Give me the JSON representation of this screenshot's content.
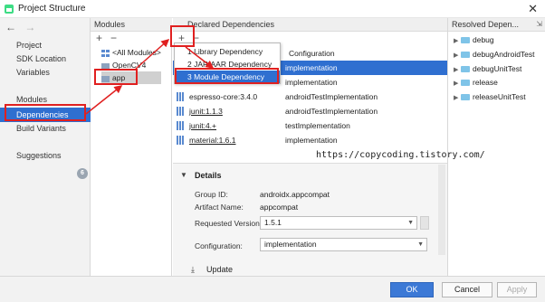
{
  "window": {
    "title": "Project Structure",
    "close_glyph": "✕"
  },
  "nav": {
    "back_glyph": "←",
    "forward_glyph": "→",
    "items": [
      {
        "label": "Project"
      },
      {
        "label": "SDK Location"
      },
      {
        "label": "Variables"
      },
      {
        "label": "Modules"
      },
      {
        "label": "Dependencies"
      },
      {
        "label": "Build Variants"
      },
      {
        "label": "Suggestions"
      }
    ],
    "suggestions_count": "6"
  },
  "modules": {
    "header": "Modules",
    "add_glyph": "+",
    "remove_glyph": "−",
    "items": [
      {
        "label": "<All Modules>"
      },
      {
        "label": "OpenCV4"
      },
      {
        "label": "app"
      }
    ]
  },
  "deps": {
    "header": "Declared Dependencies",
    "add_glyph": "+",
    "remove_glyph": "−",
    "config_header": "Configuration",
    "rows": [
      {
        "name": "",
        "conf": "implementation"
      },
      {
        "name": "",
        "conf": "implementation"
      },
      {
        "name": "espresso-core:3.4.0",
        "conf": "androidTestImplementation"
      },
      {
        "name": "junit:1.1.3",
        "conf": "androidTestImplementation"
      },
      {
        "name": "junit:4.+",
        "conf": "testImplementation"
      },
      {
        "name": "material:1.6.1",
        "conf": "implementation"
      }
    ],
    "popup": [
      {
        "label": "1  Library Dependency"
      },
      {
        "label": "2  JAR/AAR Dependency"
      },
      {
        "label": "3  Module Dependency"
      }
    ]
  },
  "details": {
    "title": "Details",
    "group_label": "Group ID:",
    "group_value": "androidx.appcompat",
    "artifact_label": "Artifact Name:",
    "artifact_value": "appcompat",
    "version_label": "Requested Version:",
    "version_value": "1.5.1",
    "config_label": "Configuration:",
    "config_value": "implementation",
    "update_label": "Update"
  },
  "resolved": {
    "header": "Resolved Depen...",
    "items": [
      {
        "label": "debug"
      },
      {
        "label": "debugAndroidTest"
      },
      {
        "label": "debugUnitTest"
      },
      {
        "label": "release"
      },
      {
        "label": "releaseUnitTest"
      }
    ]
  },
  "buttons": {
    "ok": "OK",
    "cancel": "Cancel",
    "apply": "Apply"
  },
  "watermark": "https://copycoding.tistory.com/",
  "colors": {
    "selection": "#2f6fd0",
    "annotation": "#e02020",
    "primary": "#3c79d6"
  }
}
